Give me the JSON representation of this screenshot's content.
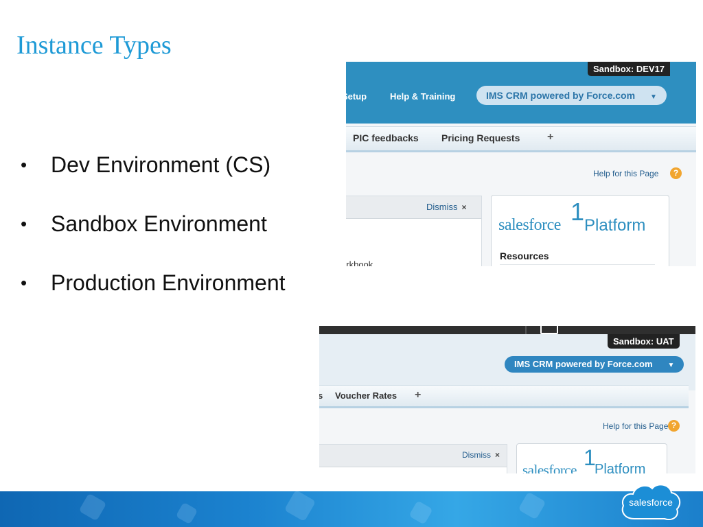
{
  "slide": {
    "title": "Instance Types",
    "bullets": [
      "Dev Environment (CS)",
      "Sandbox Environment",
      "Production Environment"
    ],
    "bullet_glyph": "•"
  },
  "screenshot_dev": {
    "sandbox_label": "Sandbox:  DEV17",
    "nav_partial": "Setup",
    "help_training": "Help & Training",
    "app_switcher": "IMS CRM powered by Force.com",
    "tabs": [
      "PIC feedbacks",
      "Pricing Requests"
    ],
    "plus": "+",
    "help_page": "Help for this Page",
    "help_icon": "?",
    "dismiss": "Dismiss",
    "dismiss_x": "×",
    "logo_word": "salesforce",
    "logo_one": "1",
    "logo_platform": "Platform",
    "resources": "Resources",
    "partial_text": "Workbook"
  },
  "screenshot_uat": {
    "sandbox_label": "Sandbox:  UAT",
    "app_switcher": "IMS CRM powered by Force.com",
    "tab_partial": "s",
    "tabs": [
      "Voucher Rates"
    ],
    "plus": "+",
    "help_page": "Help for this Page",
    "help_icon": "?",
    "dismiss": "Dismiss",
    "dismiss_x": "×",
    "logo_word": "salesforce",
    "logo_one": "1",
    "logo_platform": "Platform"
  },
  "footer": {
    "brand": "salesforce",
    "colors": {
      "band_dark": "#0f67b3",
      "band_light": "#35a7e6",
      "cloud": "#1c8ed6"
    }
  },
  "colors": {
    "title": "#1e9ad6",
    "accent": "#2e8fc0"
  }
}
